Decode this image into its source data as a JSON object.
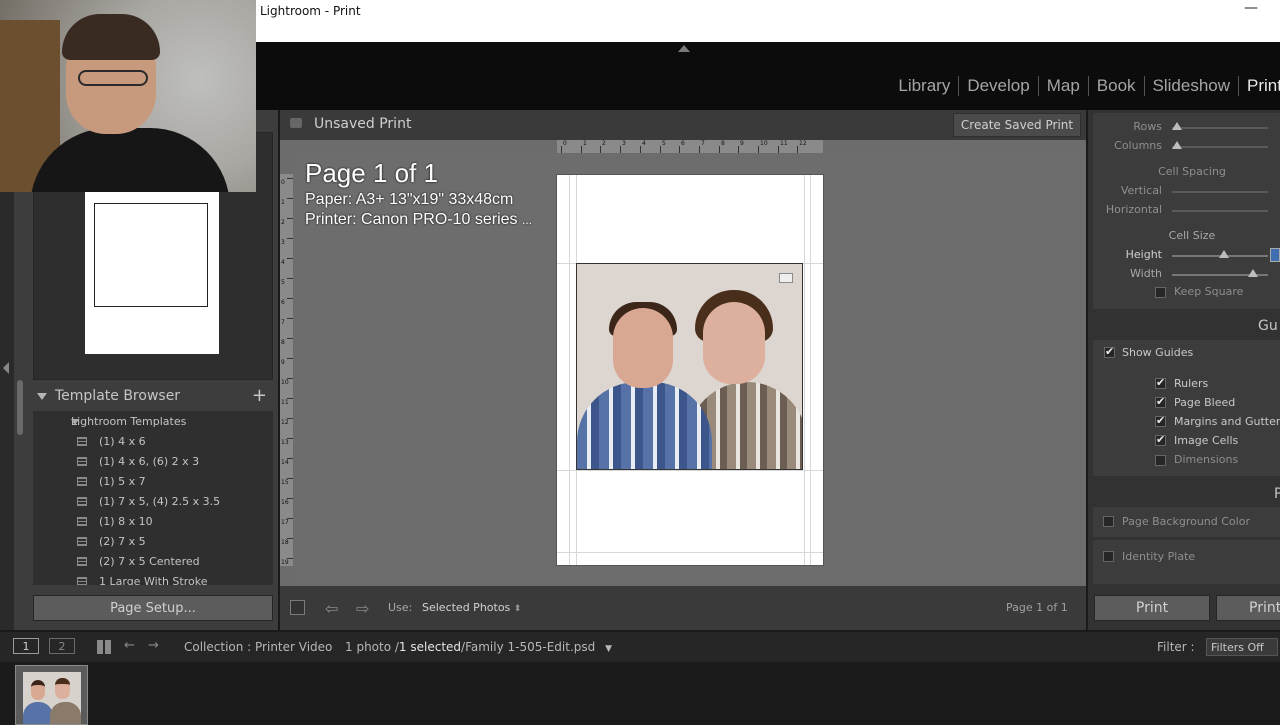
{
  "window": {
    "title": "Lightroom - Print",
    "minimize_glyph": "—"
  },
  "modules": {
    "items": [
      {
        "label": "Library"
      },
      {
        "label": "Develop"
      },
      {
        "label": "Map"
      },
      {
        "label": "Book"
      },
      {
        "label": "Slideshow"
      },
      {
        "label": "Print",
        "active": true
      }
    ]
  },
  "left_panel": {
    "template_browser": {
      "title": "Template Browser",
      "add_glyph": "+",
      "folder": "Lightroom Templates",
      "items": [
        "(1) 4 x 6",
        "(1) 4 x 6, (6) 2 x 3",
        "(1) 5 x 7",
        "(1) 7 x 5, (4) 2.5 x 3.5",
        "(1) 8 x 10",
        "(2) 7 x 5",
        "(2) 7 x 5 Centered",
        "1 Large With Stroke"
      ]
    },
    "page_setup_label": "Page Setup..."
  },
  "center": {
    "print_name": "Unsaved Print",
    "create_saved_label": "Create Saved Print",
    "overlay": {
      "page": "Page 1 of 1",
      "paper": "Paper:  A3+ 13\"x19\" 33x48cm",
      "printer": "Printer:  Canon PRO-10 series",
      "ellipsis": "..."
    },
    "ruler_top_labels": [
      "0",
      "1",
      "2",
      "3",
      "4",
      "5",
      "6",
      "7",
      "8",
      "9",
      "10",
      "11",
      "12"
    ],
    "ruler_left_labels": [
      "0",
      "1",
      "2",
      "3",
      "4",
      "5",
      "6",
      "7",
      "8",
      "9",
      "10",
      "11",
      "12",
      "13",
      "14",
      "15",
      "16",
      "17",
      "18",
      "19"
    ],
    "footer": {
      "use_label": "Use:",
      "use_value": "Selected Photos",
      "page_count": "Page 1 of 1",
      "prev_glyph": "⇦",
      "next_glyph": "⇨"
    }
  },
  "right_panel": {
    "layout": {
      "rows_label": "Rows",
      "columns_label": "Columns",
      "cell_spacing_label": "Cell Spacing",
      "vertical_label": "Vertical",
      "horizontal_label": "Horizontal",
      "cell_size_label": "Cell Size",
      "height_label": "Height",
      "width_label": "Width",
      "keep_square_label": "Keep Square"
    },
    "guides": {
      "title": "Gu",
      "show_guides": "Show Guides",
      "rulers": "Rulers",
      "page_bleed": "Page Bleed",
      "margins": "Margins and Gutters",
      "image_cells": "Image Cells",
      "dimensions": "Dimensions"
    },
    "page": {
      "title": "P",
      "background_color": "Page Background Color",
      "identity_plate": "Identity Plate"
    },
    "print_label": "Print",
    "printer_label": "Print"
  },
  "filmbar": {
    "screen1": "1",
    "screen2": "2",
    "collection": "Collection : Printer Video",
    "count_prefix": "1 photo /",
    "selected": "1 selected",
    "file": "/Family 1-505-Edit.psd",
    "filter_label": "Filter :",
    "filter_value": "Filters Off"
  }
}
